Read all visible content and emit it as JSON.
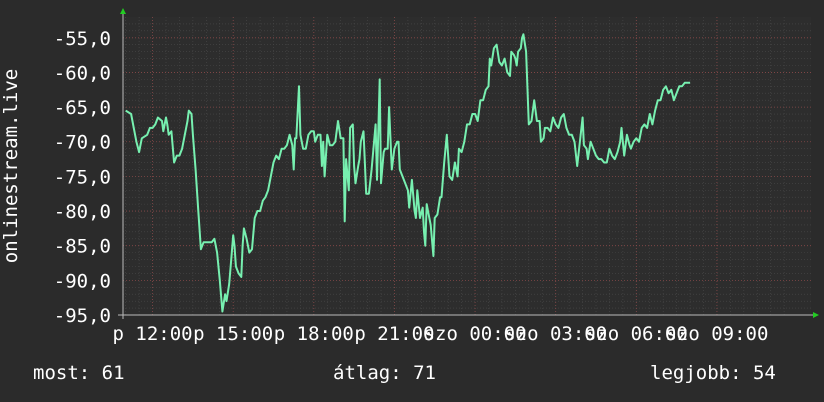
{
  "chart_data": {
    "type": "line",
    "ylabel": "onlinestream.live",
    "yticks": [
      "-55,0",
      "-60,0",
      "-65,0",
      "-70,0",
      "-75,0",
      "-80,0",
      "-85,0",
      "-90,0",
      "-95,0"
    ],
    "ylim": [
      -95,
      -52
    ],
    "xticks": [
      "p 12:00",
      "p 15:00",
      "p 18:00",
      "p 21:00",
      "szo 00:00",
      "szo 03:00",
      "szo 06:00",
      "szo 09:00"
    ],
    "x_hours": [
      0,
      3,
      6,
      9,
      12,
      15,
      18,
      21
    ],
    "xlim": [
      -1.1,
      24.5
    ],
    "line_color": "#77f0b0",
    "grid": true,
    "series": [
      {
        "values": [
          [
            -1.0,
            -65.5
          ],
          [
            -0.8,
            -66
          ],
          [
            -0.6,
            -70
          ],
          [
            -0.5,
            -71.5
          ],
          [
            -0.4,
            -69.5
          ],
          [
            -0.2,
            -69
          ],
          [
            -0.1,
            -68
          ],
          [
            0.0,
            -68
          ],
          [
            0.1,
            -67.5
          ],
          [
            0.2,
            -66.5
          ],
          [
            0.35,
            -67
          ],
          [
            0.4,
            -68.5
          ],
          [
            0.5,
            -66.5
          ],
          [
            0.55,
            -67.5
          ],
          [
            0.6,
            -69
          ],
          [
            0.7,
            -68.5
          ],
          [
            0.8,
            -73
          ],
          [
            0.9,
            -72
          ],
          [
            1.0,
            -72
          ],
          [
            1.1,
            -71
          ],
          [
            1.2,
            -69
          ],
          [
            1.3,
            -67
          ],
          [
            1.35,
            -65.5
          ],
          [
            1.45,
            -66
          ],
          [
            1.5,
            -69
          ],
          [
            1.6,
            -74
          ],
          [
            1.7,
            -80
          ],
          [
            1.8,
            -85.5
          ],
          [
            1.9,
            -84.5
          ],
          [
            2.0,
            -84.5
          ],
          [
            2.2,
            -84.5
          ],
          [
            2.3,
            -84
          ],
          [
            2.4,
            -86
          ],
          [
            2.5,
            -90
          ],
          [
            2.6,
            -94.5
          ],
          [
            2.7,
            -92
          ],
          [
            2.75,
            -93
          ],
          [
            2.85,
            -90.5
          ],
          [
            2.95,
            -86
          ],
          [
            3.0,
            -83.5
          ],
          [
            3.05,
            -85
          ],
          [
            3.1,
            -88
          ],
          [
            3.2,
            -89
          ],
          [
            3.3,
            -89.5
          ],
          [
            3.35,
            -85
          ],
          [
            3.4,
            -82.5
          ],
          [
            3.5,
            -84
          ],
          [
            3.6,
            -86
          ],
          [
            3.7,
            -85.5
          ],
          [
            3.8,
            -81
          ],
          [
            3.9,
            -80
          ],
          [
            4.0,
            -80
          ],
          [
            4.1,
            -78.5
          ],
          [
            4.2,
            -78
          ],
          [
            4.3,
            -77
          ],
          [
            4.4,
            -75
          ],
          [
            4.5,
            -73
          ],
          [
            4.6,
            -72
          ],
          [
            4.7,
            -72.5
          ],
          [
            4.8,
            -71
          ],
          [
            4.9,
            -71
          ],
          [
            5.0,
            -70.5
          ],
          [
            5.1,
            -69
          ],
          [
            5.2,
            -70.5
          ],
          [
            5.25,
            -74
          ],
          [
            5.3,
            -69.5
          ],
          [
            5.35,
            -69.5
          ],
          [
            5.45,
            -62
          ],
          [
            5.5,
            -69
          ],
          [
            5.6,
            -71
          ],
          [
            5.7,
            -71
          ],
          [
            5.8,
            -69
          ],
          [
            5.9,
            -68.5
          ],
          [
            6.0,
            -68.5
          ],
          [
            6.05,
            -70
          ],
          [
            6.15,
            -69
          ],
          [
            6.25,
            -69
          ],
          [
            6.3,
            -73.5
          ],
          [
            6.35,
            -70
          ],
          [
            6.4,
            -75
          ],
          [
            6.5,
            -69
          ],
          [
            6.6,
            -70.5
          ],
          [
            6.7,
            -70.5
          ],
          [
            6.8,
            -70
          ],
          [
            6.9,
            -67
          ],
          [
            7.0,
            -69.5
          ],
          [
            7.1,
            -69.5
          ],
          [
            7.15,
            -81.5
          ],
          [
            7.2,
            -72.5
          ],
          [
            7.3,
            -77
          ],
          [
            7.35,
            -68
          ],
          [
            7.45,
            -67.5
          ],
          [
            7.5,
            -73.5
          ],
          [
            7.55,
            -76
          ],
          [
            7.65,
            -73.5
          ],
          [
            7.7,
            -72.5
          ],
          [
            7.75,
            -70
          ],
          [
            7.85,
            -68.5
          ],
          [
            7.95,
            -77.5
          ],
          [
            8.05,
            -77.5
          ],
          [
            8.15,
            -74
          ],
          [
            8.3,
            -67.5
          ],
          [
            8.35,
            -75.5
          ],
          [
            8.45,
            -61
          ],
          [
            8.5,
            -76
          ],
          [
            8.6,
            -71.5
          ],
          [
            8.65,
            -71
          ],
          [
            8.75,
            -71
          ],
          [
            8.8,
            -65
          ],
          [
            8.9,
            -74
          ],
          [
            9.0,
            -71
          ],
          [
            9.1,
            -70
          ],
          [
            9.15,
            -70
          ],
          [
            9.2,
            -74
          ],
          [
            9.3,
            -75
          ],
          [
            9.4,
            -76
          ],
          [
            9.5,
            -77
          ],
          [
            9.55,
            -79.5
          ],
          [
            9.65,
            -75.5
          ],
          [
            9.75,
            -80
          ],
          [
            9.8,
            -81
          ],
          [
            9.85,
            -77
          ],
          [
            9.95,
            -81
          ],
          [
            10.05,
            -79.5
          ],
          [
            10.1,
            -83
          ],
          [
            10.15,
            -85
          ],
          [
            10.2,
            -79
          ],
          [
            10.25,
            -80
          ],
          [
            10.35,
            -82
          ],
          [
            10.45,
            -86.5
          ],
          [
            10.5,
            -81
          ],
          [
            10.6,
            -80.5
          ],
          [
            10.7,
            -78
          ],
          [
            10.75,
            -78
          ],
          [
            10.85,
            -73
          ],
          [
            10.95,
            -69
          ],
          [
            11.05,
            -75
          ],
          [
            11.15,
            -75.5
          ],
          [
            11.25,
            -73
          ],
          [
            11.35,
            -75
          ],
          [
            11.4,
            -71
          ],
          [
            11.5,
            -71.5
          ],
          [
            11.6,
            -70
          ],
          [
            11.7,
            -67.5
          ],
          [
            11.8,
            -67.5
          ],
          [
            11.9,
            -66
          ],
          [
            12.0,
            -66
          ],
          [
            12.1,
            -67
          ],
          [
            12.2,
            -64
          ],
          [
            12.3,
            -64
          ],
          [
            12.4,
            -62.5
          ],
          [
            12.5,
            -62
          ],
          [
            12.55,
            -58
          ],
          [
            12.6,
            -59
          ],
          [
            12.7,
            -56.5
          ],
          [
            12.8,
            -56
          ],
          [
            12.9,
            -58.5
          ],
          [
            13.0,
            -59
          ],
          [
            13.1,
            -58
          ],
          [
            13.2,
            -60
          ],
          [
            13.3,
            -60.5
          ],
          [
            13.35,
            -57
          ],
          [
            13.45,
            -57.5
          ],
          [
            13.5,
            -58
          ],
          [
            13.55,
            -59
          ],
          [
            13.6,
            -57
          ],
          [
            13.7,
            -56.5
          ],
          [
            13.75,
            -55
          ],
          [
            13.8,
            -54.5
          ],
          [
            13.9,
            -57
          ],
          [
            14.0,
            -67.5
          ],
          [
            14.1,
            -67
          ],
          [
            14.2,
            -64
          ],
          [
            14.3,
            -67
          ],
          [
            14.4,
            -67
          ],
          [
            14.45,
            -70
          ],
          [
            14.55,
            -69.5
          ],
          [
            14.6,
            -68
          ],
          [
            14.7,
            -68
          ],
          [
            14.8,
            -68.5
          ],
          [
            14.9,
            -66.5
          ],
          [
            15.0,
            -67.5
          ],
          [
            15.1,
            -68
          ],
          [
            15.2,
            -66.5
          ],
          [
            15.3,
            -66
          ],
          [
            15.4,
            -68
          ],
          [
            15.5,
            -69
          ],
          [
            15.6,
            -69
          ],
          [
            15.7,
            -70
          ],
          [
            15.8,
            -73.5
          ],
          [
            15.9,
            -70
          ],
          [
            16.0,
            -66.5
          ],
          [
            16.05,
            -70.5
          ],
          [
            16.15,
            -71
          ],
          [
            16.2,
            -72.5
          ],
          [
            16.3,
            -70
          ],
          [
            16.4,
            -71
          ],
          [
            16.5,
            -72
          ],
          [
            16.6,
            -72.5
          ],
          [
            16.7,
            -72.5
          ],
          [
            16.8,
            -73
          ],
          [
            16.9,
            -73
          ],
          [
            17.0,
            -71
          ],
          [
            17.05,
            -71.5
          ],
          [
            17.1,
            -72
          ],
          [
            17.2,
            -72.5
          ],
          [
            17.3,
            -71.5
          ],
          [
            17.4,
            -70
          ],
          [
            17.45,
            -68
          ],
          [
            17.55,
            -72
          ],
          [
            17.65,
            -69
          ],
          [
            17.75,
            -70.5
          ],
          [
            17.8,
            -71
          ],
          [
            17.9,
            -70
          ],
          [
            18.0,
            -69.5
          ],
          [
            18.1,
            -70
          ],
          [
            18.2,
            -68
          ],
          [
            18.3,
            -67.5
          ],
          [
            18.4,
            -68
          ],
          [
            18.5,
            -66
          ],
          [
            18.6,
            -67.5
          ],
          [
            18.7,
            -65.5
          ],
          [
            18.8,
            -64
          ],
          [
            18.9,
            -64
          ],
          [
            19.0,
            -62.5
          ],
          [
            19.1,
            -62
          ],
          [
            19.2,
            -63
          ],
          [
            19.3,
            -62.5
          ],
          [
            19.4,
            -64
          ],
          [
            19.5,
            -63
          ],
          [
            19.6,
            -62
          ],
          [
            19.7,
            -62
          ],
          [
            19.8,
            -61.5
          ],
          [
            20.0,
            -61.5
          ]
        ]
      }
    ]
  },
  "footer": {
    "now": "most: 61",
    "avg": "átlag: 71",
    "best": "legjobb: 54"
  }
}
